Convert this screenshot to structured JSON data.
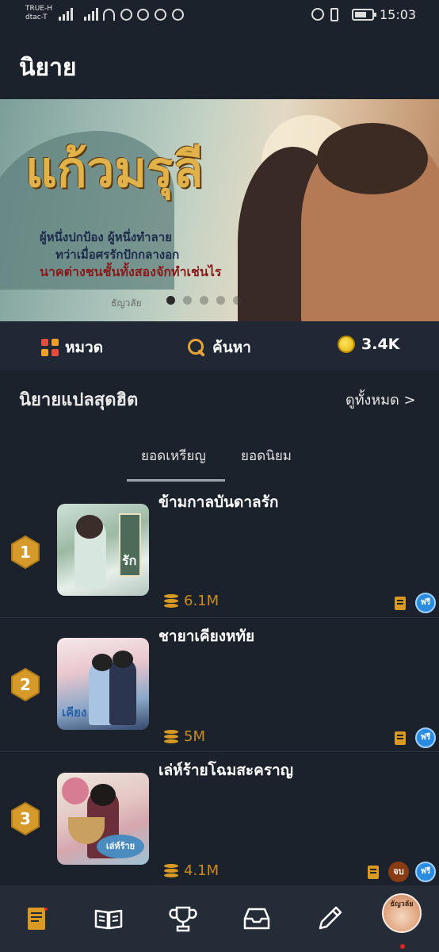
{
  "status_bar": {
    "carrier_line1": "TRUE-H",
    "carrier_line2": "dtac-T",
    "time": "15:03"
  },
  "app_title": "นิยาย",
  "banner": {
    "title": "แก้วมรุลี",
    "line1": "ผู้หนึ่งปกป้อง ผู้หนึ่งทำลาย",
    "line2": "ทว่าเมื่อศรรักปักกลางอก",
    "line3": "นาคต่างชนชั้นทั้งสองจักทำเช่นไร",
    "author": "ธัญวลัย",
    "active_dot": 0,
    "dot_count": 5
  },
  "nav": {
    "category": "หมวด",
    "search": "ค้นหา",
    "coins": "3.4K"
  },
  "section": {
    "title": "นิยายแปลสุดฮิต",
    "see_all": "ดูทั้งหมด >",
    "tabs": [
      "ยอดเหรียญ",
      "ยอดนิยม"
    ],
    "active_tab": 0
  },
  "books": [
    {
      "rank": "1",
      "title": "ข้ามกาลบันดาลรัก",
      "coins": "6.1M",
      "free": "ฟรี",
      "completed": ""
    },
    {
      "rank": "2",
      "title": "ชายาเคียงหทัย",
      "coins": "5M",
      "free": "ฟรี",
      "completed": ""
    },
    {
      "rank": "3",
      "title": "เล่ห์ร้ายโฉมสะคราญ",
      "coins": "4.1M",
      "free": "ฟรี",
      "completed": "จบ"
    }
  ],
  "bottom_nav": {
    "items": [
      "novel-icon",
      "reading-icon",
      "trophy-icon",
      "inbox-icon",
      "pencil-icon",
      "avatar"
    ],
    "avatar_label": "ธัญวลัย"
  },
  "colors": {
    "background": "#1b222c",
    "accent": "#d99a23",
    "badge": "#c98a20",
    "free": "#2a8ce0"
  }
}
